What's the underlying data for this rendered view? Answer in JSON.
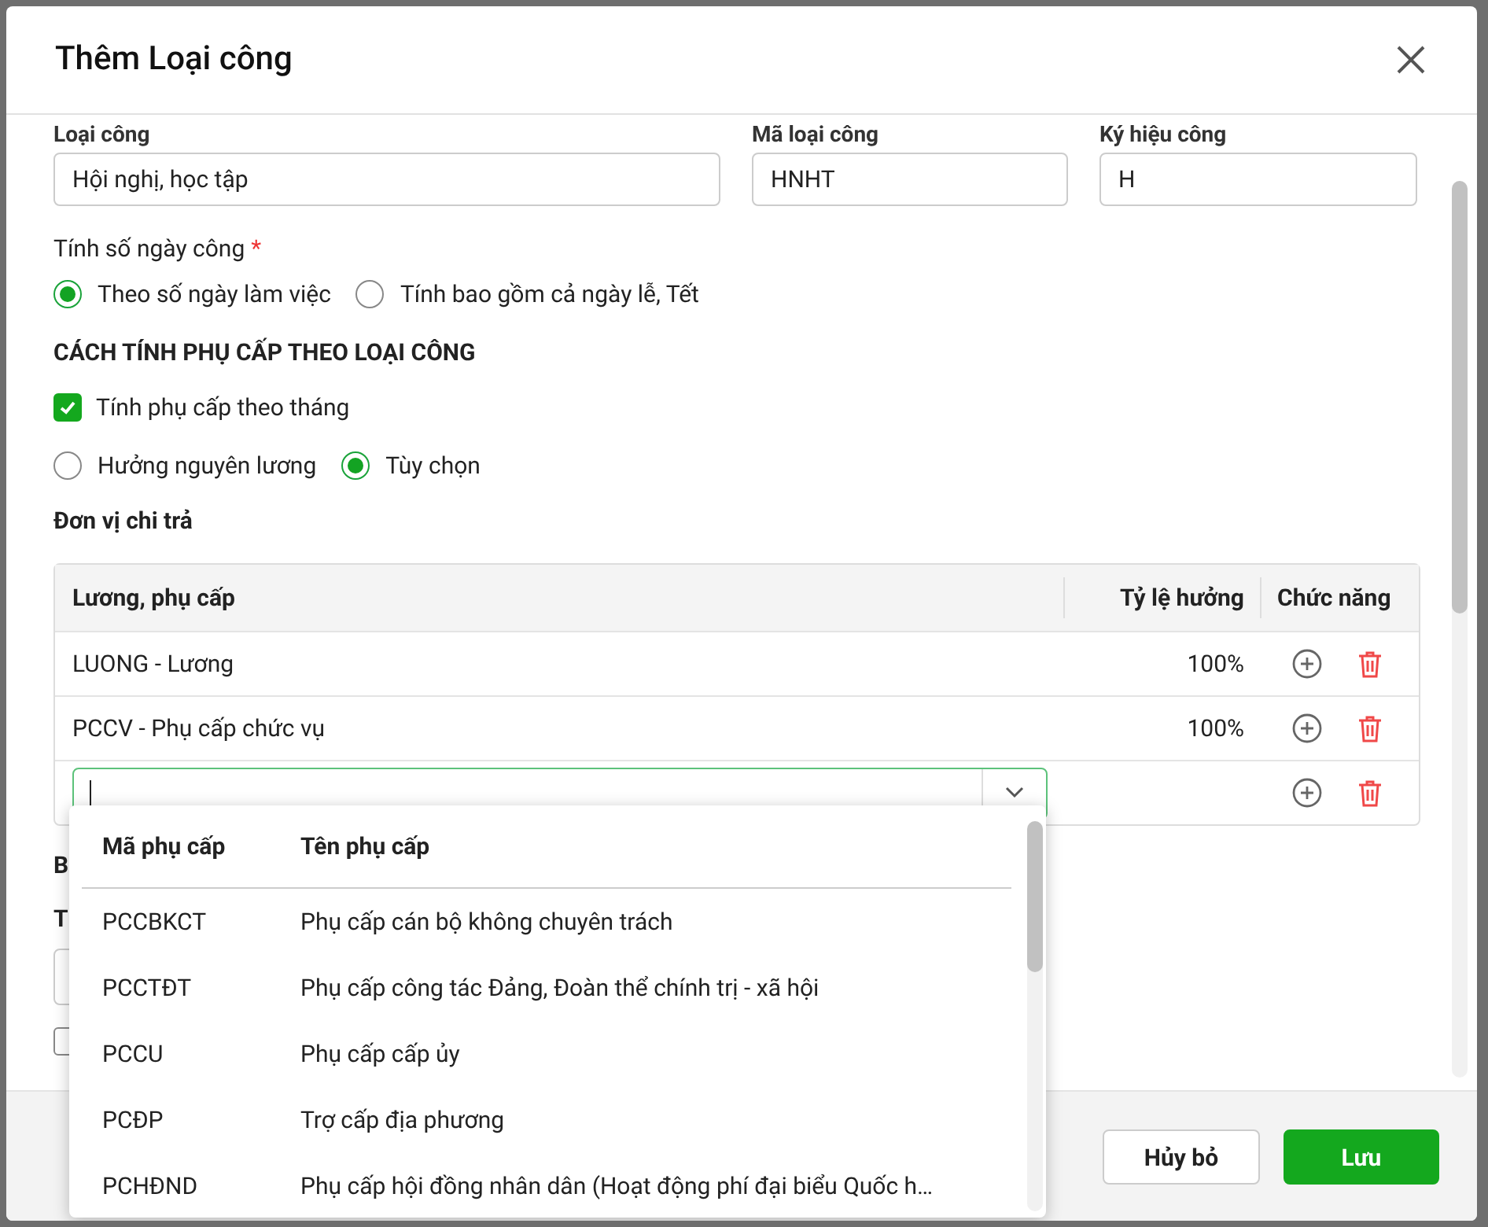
{
  "dialog": {
    "title": "Thêm Loại công"
  },
  "fields": [
    {
      "label": "Loại công",
      "value": "Hội nghị, học tập"
    },
    {
      "label": "Mã loại công",
      "value": "HNHT"
    },
    {
      "label": "Ký hiệu công",
      "value": "H"
    }
  ],
  "day_count": {
    "label": "Tính số ngày công",
    "required_mark": "*",
    "options": [
      {
        "label": "Theo số ngày làm việc",
        "selected": true
      },
      {
        "label": "Tính bao gồm cả ngày lễ, Tết",
        "selected": false
      }
    ]
  },
  "section_title": "CÁCH TÍNH PHỤ CẤP THEO LOẠI CÔNG",
  "monthly": {
    "label": "Tính phụ cấp theo tháng",
    "checked": true
  },
  "pay_options": [
    {
      "label": "Hưởng nguyên lương",
      "selected": false
    },
    {
      "label": "Tùy chọn",
      "selected": true
    }
  ],
  "payer_label": "Đơn vị chi trả",
  "table": {
    "columns": [
      "Lương, phụ cấp",
      "Tỷ lệ hưởng",
      "Chức năng"
    ],
    "rows": [
      {
        "name": "LUONG - Lương",
        "ratio": "100%"
      },
      {
        "name": "PCCV - Phụ cấp chức vụ",
        "ratio": "100%"
      }
    ]
  },
  "dropdown": {
    "columns": [
      "Mã phụ cấp",
      "Tên phụ cấp"
    ],
    "items": [
      {
        "code": "PCCBKCT",
        "name": "Phụ cấp cán bộ không chuyên trách"
      },
      {
        "code": "PCCTĐT",
        "name": "Phụ cấp công tác Đảng, Đoàn thể chính trị - xã hội"
      },
      {
        "code": "PCCU",
        "name": "Phụ cấp cấp ủy"
      },
      {
        "code": "PCĐP",
        "name": "Trợ cấp địa phương"
      },
      {
        "code": "PCHĐND",
        "name": "Phụ cấp hội đồng nhân dân (Hoạt động phí đại biểu Quốc h…"
      }
    ]
  },
  "covered_labels": [
    "B",
    "T"
  ],
  "covered_checkbox": {
    "checked": false
  },
  "buttons": [
    {
      "label": "Hủy bỏ",
      "kind": "secondary"
    },
    {
      "label": "Lưu",
      "kind": "primary"
    }
  ]
}
